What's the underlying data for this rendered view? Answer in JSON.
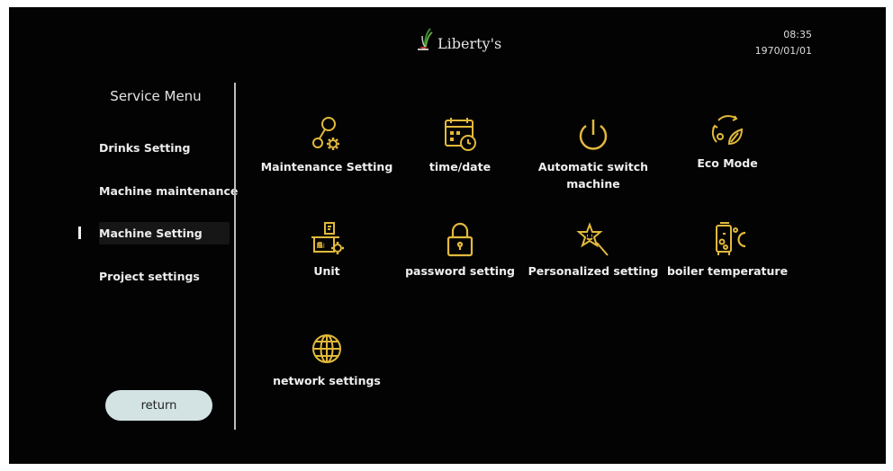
{
  "header": {
    "brand": "Liberty's",
    "time": "08:35",
    "date": "1970/01/01"
  },
  "sidebar": {
    "title": "Service Menu",
    "items": [
      {
        "label": "Drinks Setting"
      },
      {
        "label": "Machine maintenance"
      },
      {
        "label": "Machine Setting",
        "active": true
      },
      {
        "label": "Project settings"
      }
    ],
    "return_label": "return"
  },
  "settings": [
    {
      "label": "Maintenance Setting",
      "icon": "maintenance-gear-icon"
    },
    {
      "label": "time/date",
      "icon": "calendar-clock-icon"
    },
    {
      "label": "Automatic switch machine",
      "icon": "power-icon"
    },
    {
      "label": "Eco Mode",
      "icon": "eco-leaf-icon"
    },
    {
      "label": "Unit",
      "icon": "unit-scale-icon"
    },
    {
      "label": "password setting",
      "icon": "lock-icon"
    },
    {
      "label": "Personalized setting",
      "icon": "star-wand-icon"
    },
    {
      "label": "boiler temperature",
      "icon": "boiler-thermometer-icon"
    },
    {
      "label": "network settings",
      "icon": "globe-icon"
    }
  ],
  "colors": {
    "icon": "#e2b93b",
    "background": "#030303",
    "button": "#d3e3e3"
  }
}
